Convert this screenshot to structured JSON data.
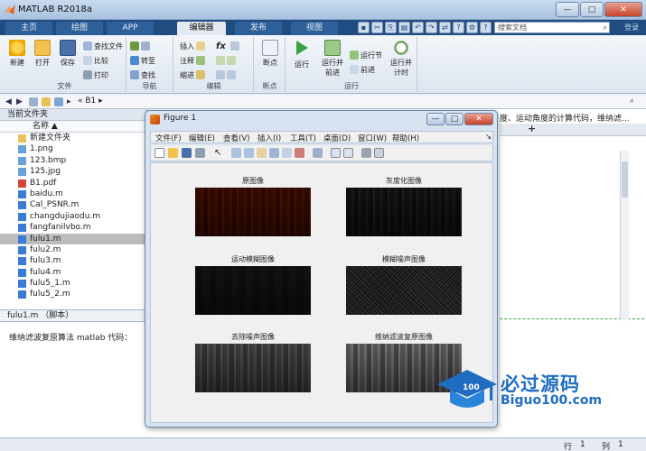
{
  "window": {
    "title": "MATLAB R2018a",
    "min_label": "—",
    "max_label": "□",
    "close_label": "✕"
  },
  "tabs": [
    "主页",
    "绘图",
    "APP",
    "编辑器",
    "发布",
    "视图"
  ],
  "active_tab": "编辑器",
  "search_docs_placeholder": "搜索文档",
  "login_label": "登录",
  "ribbon": {
    "file_group": {
      "label": "文件",
      "new": "新建",
      "open": "打开",
      "save": "保存",
      "find_files": "查找文件",
      "compare": "比较",
      "print": "打印"
    },
    "nav_group": {
      "label": "导航",
      "goto": "转至",
      "find": "查找"
    },
    "edit_group": {
      "label": "编辑",
      "insert": "插入",
      "comment": "注释",
      "indent": "缩进",
      "fx": "fx"
    },
    "breakpoint_group": {
      "label": "断点",
      "breakpoints": "断点"
    },
    "run_group": {
      "label": "运行",
      "run": "运行",
      "run_advance": "运行并\n前进",
      "run_section": "运行节",
      "advance": "前进",
      "run_time": "运行并\n计时"
    }
  },
  "path": {
    "crumb": "« B1 ▸"
  },
  "current_folder": {
    "title": "当前文件夹",
    "name_header": "名称 ▲",
    "files": [
      {
        "name": "新建文件夹",
        "type": "folder"
      },
      {
        "name": "1.png",
        "type": "image"
      },
      {
        "name": "123.bmp",
        "type": "image"
      },
      {
        "name": "125.jpg",
        "type": "image"
      },
      {
        "name": "B1.pdf",
        "type": "pdf"
      },
      {
        "name": "baidu.m",
        "type": "m"
      },
      {
        "name": "Cal_PSNR.m",
        "type": "m"
      },
      {
        "name": "changdujiaodu.m",
        "type": "m"
      },
      {
        "name": "fangfanilvbo.m",
        "type": "m"
      },
      {
        "name": "fulu1.m",
        "type": "m",
        "selected": true
      },
      {
        "name": "fulu2.m",
        "type": "m"
      },
      {
        "name": "fulu3.m",
        "type": "m"
      },
      {
        "name": "fulu4.m",
        "type": "m"
      },
      {
        "name": "fulu5_1.m",
        "type": "m"
      },
      {
        "name": "fulu5_2.m",
        "type": "m"
      }
    ]
  },
  "details_label": "fulu1.m （脚本）",
  "editor_snippet": "度、运动角度的计算代码，维纳滤...",
  "editor_add_tab": "+",
  "command_text": "维纳滤波复原算法 matlab 代码：",
  "status": {
    "row_label": "行",
    "row_value": "1",
    "col_label": "列",
    "col_value": "1"
  },
  "figure": {
    "title": "Figure 1",
    "menu": [
      "文件(F)",
      "编辑(E)",
      "查看(V)",
      "插入(I)",
      "工具(T)",
      "桌面(D)",
      "窗口(W)",
      "帮助(H)"
    ],
    "menu_arrow": "↘",
    "subplots": [
      {
        "title": "原图像",
        "style": "original"
      },
      {
        "title": "灰度化图像",
        "style": "gray"
      },
      {
        "title": "运动模糊图像",
        "style": "blur"
      },
      {
        "title": "模糊噪声图像",
        "style": "noise"
      },
      {
        "title": "去除噪声图像",
        "style": "denoise"
      },
      {
        "title": "维纳滤波复原图像",
        "style": "wiener"
      }
    ]
  },
  "watermark": {
    "line1": "必过源码",
    "line2": "Biguo100.com"
  },
  "colors": {
    "tab_bar": "#1f4d82",
    "brand": "#1f6dc2",
    "selected_row": "#bcbcbc"
  }
}
